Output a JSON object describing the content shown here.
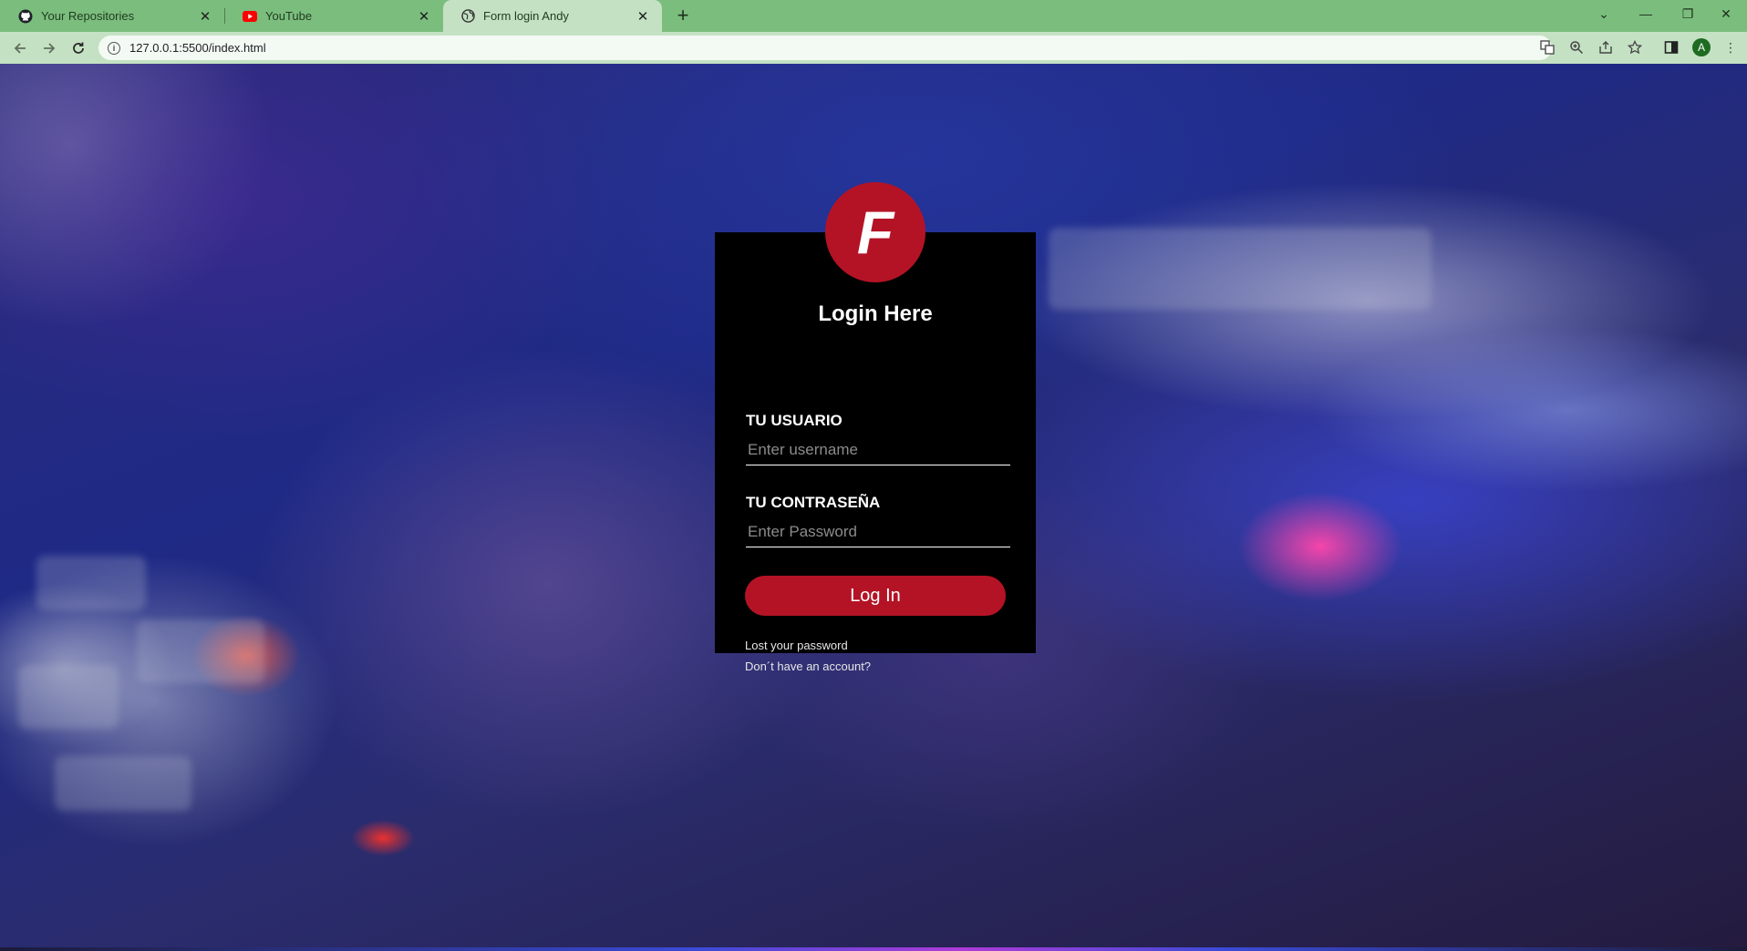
{
  "browser": {
    "tabs": [
      {
        "label": "Your Repositories",
        "icon": "github-icon"
      },
      {
        "label": "YouTube",
        "icon": "youtube-icon"
      },
      {
        "label": "Form login Andy",
        "icon": "globe-icon",
        "active": true
      }
    ],
    "url": "127.0.0.1:5500/index.html",
    "profile_initial": "A",
    "colors": {
      "tabbar": "#7bbd7d",
      "toolbar": "#c4e2c3"
    }
  },
  "login": {
    "logo_letter": "F",
    "title": "Login Here",
    "username_label": "TU USUARIO",
    "username_placeholder": "Enter username",
    "password_label": "TU CONTRASEÑA",
    "password_placeholder": "Enter Password",
    "submit_label": "Log In",
    "lost_password_link": "Lost your password",
    "signup_link": "Don´t have an account?",
    "colors": {
      "accent": "#b41326",
      "card": "#000000"
    }
  }
}
